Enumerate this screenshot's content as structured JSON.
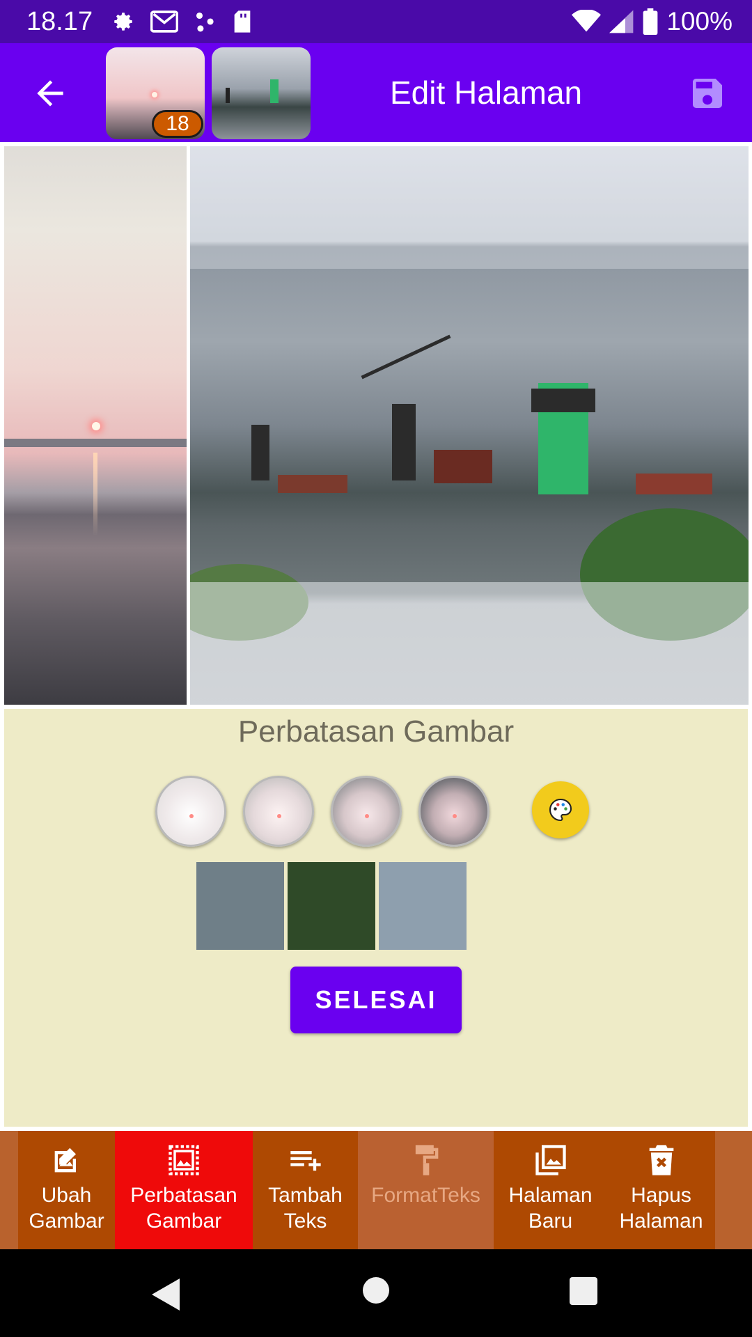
{
  "status_bar": {
    "time": "18.17",
    "battery": "100%",
    "icons": [
      "settings-icon",
      "gmail-icon",
      "dots-icon",
      "sd-card-icon",
      "wifi-icon",
      "signal-icon",
      "battery-icon"
    ]
  },
  "app_bar": {
    "title": "Edit Halaman",
    "thumb_badge": "18",
    "icons": [
      "back-arrow-icon",
      "save-icon"
    ]
  },
  "panel": {
    "title": "Perbatasan Gambar",
    "swatches": [
      "#6f7f88",
      "#2f4a28",
      "#8e9fae"
    ],
    "done_label": "SELESAI"
  },
  "toolbar": {
    "items": [
      {
        "line1": "Ubah",
        "line2": "Gambar",
        "icon": "edit-image-icon"
      },
      {
        "line1": "Perbatasan",
        "line2": "Gambar",
        "icon": "border-image-icon"
      },
      {
        "line1": "Tambah",
        "line2": "Teks",
        "icon": "add-text-icon"
      },
      {
        "line1": "FormatTeks",
        "line2": "",
        "icon": "format-paint-icon"
      },
      {
        "line1": "Halaman",
        "line2": "Baru",
        "icon": "new-page-icon"
      },
      {
        "line1": "Hapus",
        "line2": "Halaman",
        "icon": "delete-page-icon"
      }
    ]
  },
  "colors": {
    "status_bar": "#4a0aa8",
    "app_bar": "#6a00f0",
    "panel_bg": "#eeebc7",
    "toolbar_bg": "#ae4902",
    "toolbar_active": "#ef0a0a",
    "palette_button": "#f2cb1c"
  }
}
